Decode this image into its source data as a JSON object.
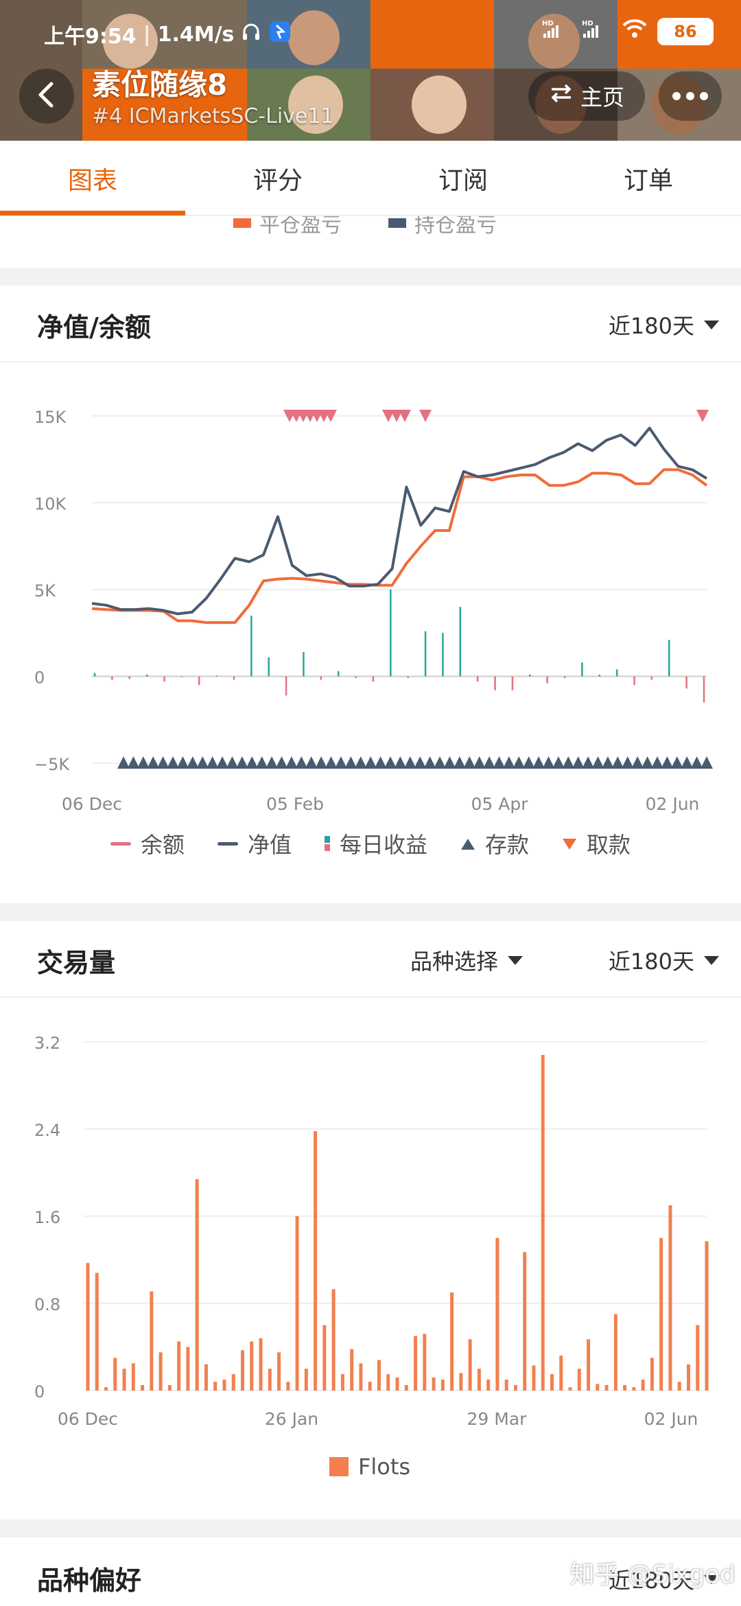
{
  "status": {
    "time": "上午9:54",
    "speed": "1.4M/s",
    "signal": "HD",
    "battery": "86"
  },
  "header": {
    "title": "素位随缘8",
    "subtitle": "#4 ICMarketsSC-Live11",
    "home_label": "主页"
  },
  "tabs": [
    {
      "label": "图表"
    },
    {
      "label": "评分"
    },
    {
      "label": "订阅"
    },
    {
      "label": "订单"
    }
  ],
  "strip_legend": {
    "left": "平仓盈亏",
    "right": "持仓盈亏"
  },
  "equity_card": {
    "title": "净值/余额",
    "period": "近180天",
    "legend": [
      {
        "label": "余额",
        "color": "#e5707e"
      },
      {
        "label": "净值",
        "color": "#4a5a70"
      },
      {
        "label": "每日收益",
        "color": "#26a69a"
      },
      {
        "label": "存款",
        "color": "#4a5a70"
      },
      {
        "label": "取款",
        "color": "#f26b38"
      }
    ]
  },
  "volume_card": {
    "title": "交易量",
    "symbol_select": "品种选择",
    "period": "近180天",
    "legend_label": "Flots"
  },
  "next_card": {
    "title": "品种偏好",
    "period": "近180天"
  },
  "watermark": "知乎 @Sixgod",
  "chart_data": [
    {
      "type": "line",
      "ylim": [
        -5000,
        15000
      ],
      "yticks": [
        "15K",
        "10K",
        "5K",
        "0",
        "−5K"
      ],
      "ytick_values": [
        15000,
        10000,
        5000,
        0,
        -5000
      ],
      "xticks": [
        "06 Dec",
        "05 Feb",
        "05 Apr",
        "02 Jun"
      ],
      "series": [
        {
          "name": "余额",
          "color": "#f26b38",
          "values": [
            3900,
            3850,
            3800,
            3800,
            3800,
            3750,
            3200,
            3200,
            3100,
            3100,
            3100,
            4100,
            5500,
            5600,
            5650,
            5600,
            5500,
            5400,
            5300,
            5300,
            5250,
            5250,
            6500,
            7500,
            8400,
            8400,
            11500,
            11500,
            11300,
            11500,
            11600,
            11600,
            11000,
            11000,
            11200,
            11700,
            11700,
            11600,
            11100,
            11100,
            11900,
            11900,
            11600,
            11000
          ]
        },
        {
          "name": "净值",
          "color": "#4a5a70",
          "values": [
            4200,
            4100,
            3850,
            3850,
            3900,
            3800,
            3600,
            3700,
            4500,
            5600,
            6800,
            6600,
            7000,
            9200,
            6400,
            5800,
            5900,
            5700,
            5200,
            5200,
            5300,
            6200,
            10900,
            8700,
            9700,
            9500,
            11800,
            11500,
            11600,
            11800,
            12000,
            12200,
            12600,
            12900,
            13400,
            13000,
            13600,
            13900,
            13300,
            14300,
            13100,
            12100,
            11900,
            11400
          ]
        }
      ],
      "daily_returns": [
        200,
        -200,
        -150,
        100,
        -300,
        -50,
        -500,
        50,
        -200,
        3500,
        1100,
        -1100,
        1400,
        -200,
        300,
        -100,
        -300,
        5000,
        -100,
        2600,
        2500,
        4000,
        -300,
        -800,
        -800,
        100,
        -400,
        -100,
        800,
        100,
        400,
        -500,
        -200,
        2100,
        -700,
        -1500
      ],
      "deposits_count": 60,
      "withdraw_markers": 12
    },
    {
      "type": "bar",
      "ylim": [
        0,
        3.2
      ],
      "yticks": [
        "3.2",
        "2.4",
        "1.6",
        "0.8",
        "0"
      ],
      "ytick_values": [
        3.2,
        2.4,
        1.6,
        0.8,
        0
      ],
      "xticks": [
        "06 Dec",
        "26 Jan",
        "29 Mar",
        "02 Jun"
      ],
      "series": [
        {
          "name": "Flots",
          "color": "#f2804f",
          "values": [
            1.17,
            1.08,
            0.03,
            0.3,
            0.2,
            0.25,
            0.05,
            0.91,
            0.35,
            0.05,
            0.45,
            0.4,
            1.94,
            0.24,
            0.08,
            0.1,
            0.15,
            0.37,
            0.45,
            0.48,
            0.2,
            0.35,
            0.08,
            1.6,
            0.2,
            2.38,
            0.6,
            0.93,
            0.15,
            0.38,
            0.25,
            0.08,
            0.28,
            0.15,
            0.12,
            0.05,
            0.5,
            0.52,
            0.12,
            0.1,
            0.9,
            0.16,
            0.47,
            0.2,
            0.1,
            1.4,
            0.1,
            0.05,
            1.27,
            0.23,
            3.08,
            0.15,
            0.32,
            0.03,
            0.2,
            0.47,
            0.06,
            0.05,
            0.7,
            0.05,
            0.03,
            0.1,
            0.3,
            1.4,
            1.7,
            0.08,
            0.24,
            0.6,
            1.37
          ]
        }
      ]
    }
  ]
}
